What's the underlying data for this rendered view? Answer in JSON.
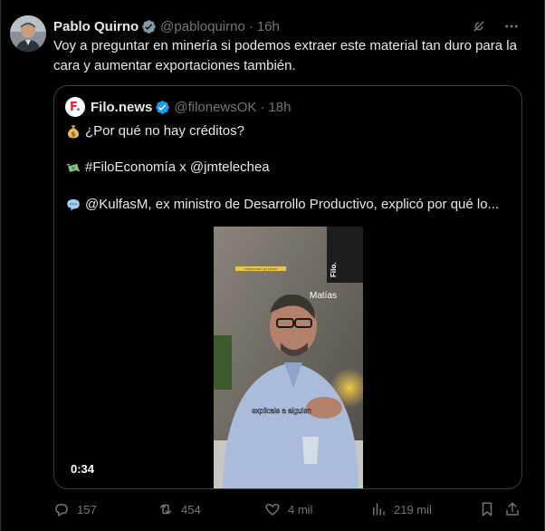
{
  "tweet": {
    "author_name": "Pablo Quirno",
    "author_handle": "@pabloquirno",
    "time": "16h",
    "separator": "·",
    "text": "Voy a preguntar en minería si podemos extraer este material tan duro para la cara y aumentar exportaciones también."
  },
  "quote": {
    "author_name": "Filo.news",
    "author_handle": "@filonewsOK",
    "time": "18h",
    "separator": "·",
    "avatar_letter": "F.",
    "line1": "¿Por qué no hay créditos?",
    "line2": "#FiloEconomía x @jmtelechea",
    "line3": "@KulfasM, ex ministro de Desarrollo Productivo, explicó por qué lo...",
    "video": {
      "duration": "0:34",
      "caption_name": "Matías",
      "caption_subtitle": "explicale a alguien",
      "watermark": "Filo.",
      "tag": "COMPLETAR LOS DATOS"
    }
  },
  "actions": {
    "replies": "157",
    "reposts": "454",
    "likes": "4 mil",
    "views": "219 mil"
  },
  "colors": {
    "background": "#000000",
    "text": "#e7e9ea",
    "muted": "#71767b",
    "verified": "#1d9bf0",
    "border": "#2f3336"
  },
  "icons": [
    "verified-badge-icon",
    "grok-icon",
    "more-icon",
    "money-bag-icon",
    "money-wings-icon",
    "speech-bubble-icon",
    "reply-icon",
    "repost-icon",
    "like-icon",
    "views-icon",
    "bookmark-icon",
    "share-icon"
  ]
}
